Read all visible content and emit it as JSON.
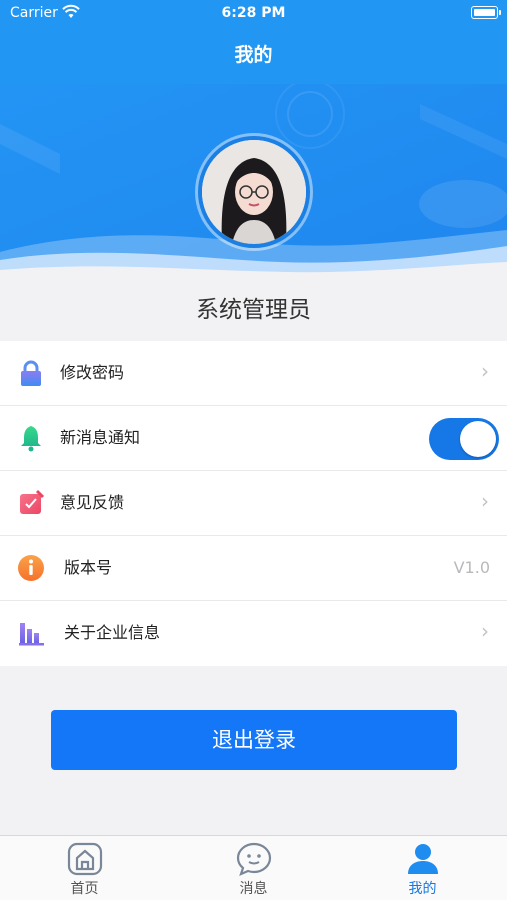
{
  "status_bar": {
    "carrier": "Carrier",
    "time": "6:28 PM",
    "icons": [
      "wifi-icon",
      "battery-icon"
    ]
  },
  "header": {
    "title": "我的"
  },
  "profile": {
    "avatar": "avatar-photo",
    "name": "系统管理员"
  },
  "menu": {
    "items": [
      {
        "label": "修改密码",
        "icon": "lock-icon",
        "trailing": "chevron",
        "color": "#3f8cf2"
      },
      {
        "label": "新消息通知",
        "icon": "bell-icon",
        "trailing": "toggle",
        "toggle_on": true,
        "color": "#2ec98a"
      },
      {
        "label": "意见反馈",
        "icon": "feedback-icon",
        "trailing": "chevron",
        "color": "#ef4f6b"
      },
      {
        "label": "版本号",
        "icon": "info-icon",
        "trailing": "value",
        "value": "V1.0",
        "color": "#f58a2e"
      },
      {
        "label": "关于企业信息",
        "icon": "company-icon",
        "trailing": "chevron",
        "color": "#8a6ee8"
      }
    ]
  },
  "logout": {
    "label": "退出登录"
  },
  "tab_bar": {
    "tabs": [
      {
        "label": "首页",
        "icon": "home-icon",
        "active": false
      },
      {
        "label": "消息",
        "icon": "chat-icon",
        "active": false
      },
      {
        "label": "我的",
        "icon": "user-icon",
        "active": true
      }
    ]
  },
  "colors": {
    "primary": "#2196f3",
    "button": "#1477f7",
    "toggle": "#1677e6",
    "background": "#f2f2f4"
  }
}
